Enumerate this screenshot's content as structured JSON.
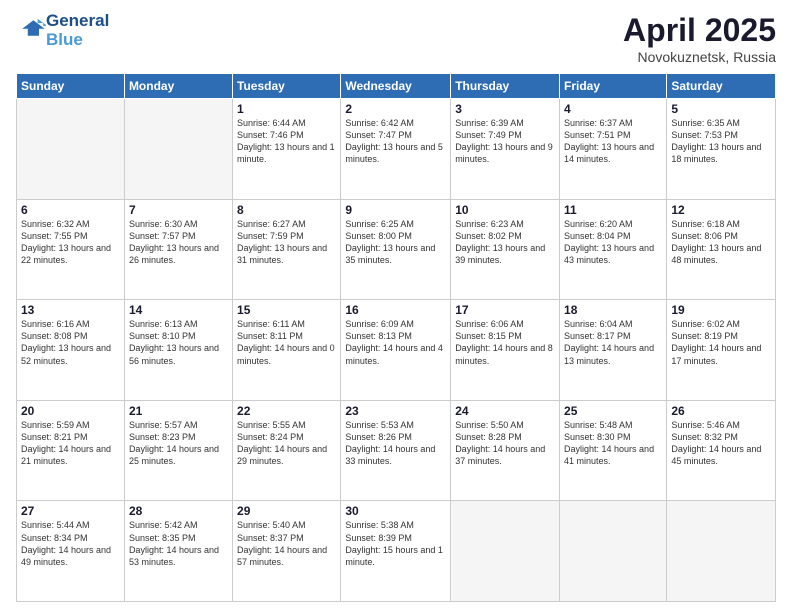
{
  "header": {
    "logo_line1": "General",
    "logo_line2": "Blue",
    "month": "April 2025",
    "location": "Novokuznetsk, Russia"
  },
  "weekdays": [
    "Sunday",
    "Monday",
    "Tuesday",
    "Wednesday",
    "Thursday",
    "Friday",
    "Saturday"
  ],
  "weeks": [
    [
      {
        "day": "",
        "info": ""
      },
      {
        "day": "",
        "info": ""
      },
      {
        "day": "1",
        "info": "Sunrise: 6:44 AM\nSunset: 7:46 PM\nDaylight: 13 hours and 1 minute."
      },
      {
        "day": "2",
        "info": "Sunrise: 6:42 AM\nSunset: 7:47 PM\nDaylight: 13 hours and 5 minutes."
      },
      {
        "day": "3",
        "info": "Sunrise: 6:39 AM\nSunset: 7:49 PM\nDaylight: 13 hours and 9 minutes."
      },
      {
        "day": "4",
        "info": "Sunrise: 6:37 AM\nSunset: 7:51 PM\nDaylight: 13 hours and 14 minutes."
      },
      {
        "day": "5",
        "info": "Sunrise: 6:35 AM\nSunset: 7:53 PM\nDaylight: 13 hours and 18 minutes."
      }
    ],
    [
      {
        "day": "6",
        "info": "Sunrise: 6:32 AM\nSunset: 7:55 PM\nDaylight: 13 hours and 22 minutes."
      },
      {
        "day": "7",
        "info": "Sunrise: 6:30 AM\nSunset: 7:57 PM\nDaylight: 13 hours and 26 minutes."
      },
      {
        "day": "8",
        "info": "Sunrise: 6:27 AM\nSunset: 7:59 PM\nDaylight: 13 hours and 31 minutes."
      },
      {
        "day": "9",
        "info": "Sunrise: 6:25 AM\nSunset: 8:00 PM\nDaylight: 13 hours and 35 minutes."
      },
      {
        "day": "10",
        "info": "Sunrise: 6:23 AM\nSunset: 8:02 PM\nDaylight: 13 hours and 39 minutes."
      },
      {
        "day": "11",
        "info": "Sunrise: 6:20 AM\nSunset: 8:04 PM\nDaylight: 13 hours and 43 minutes."
      },
      {
        "day": "12",
        "info": "Sunrise: 6:18 AM\nSunset: 8:06 PM\nDaylight: 13 hours and 48 minutes."
      }
    ],
    [
      {
        "day": "13",
        "info": "Sunrise: 6:16 AM\nSunset: 8:08 PM\nDaylight: 13 hours and 52 minutes."
      },
      {
        "day": "14",
        "info": "Sunrise: 6:13 AM\nSunset: 8:10 PM\nDaylight: 13 hours and 56 minutes."
      },
      {
        "day": "15",
        "info": "Sunrise: 6:11 AM\nSunset: 8:11 PM\nDaylight: 14 hours and 0 minutes."
      },
      {
        "day": "16",
        "info": "Sunrise: 6:09 AM\nSunset: 8:13 PM\nDaylight: 14 hours and 4 minutes."
      },
      {
        "day": "17",
        "info": "Sunrise: 6:06 AM\nSunset: 8:15 PM\nDaylight: 14 hours and 8 minutes."
      },
      {
        "day": "18",
        "info": "Sunrise: 6:04 AM\nSunset: 8:17 PM\nDaylight: 14 hours and 13 minutes."
      },
      {
        "day": "19",
        "info": "Sunrise: 6:02 AM\nSunset: 8:19 PM\nDaylight: 14 hours and 17 minutes."
      }
    ],
    [
      {
        "day": "20",
        "info": "Sunrise: 5:59 AM\nSunset: 8:21 PM\nDaylight: 14 hours and 21 minutes."
      },
      {
        "day": "21",
        "info": "Sunrise: 5:57 AM\nSunset: 8:23 PM\nDaylight: 14 hours and 25 minutes."
      },
      {
        "day": "22",
        "info": "Sunrise: 5:55 AM\nSunset: 8:24 PM\nDaylight: 14 hours and 29 minutes."
      },
      {
        "day": "23",
        "info": "Sunrise: 5:53 AM\nSunset: 8:26 PM\nDaylight: 14 hours and 33 minutes."
      },
      {
        "day": "24",
        "info": "Sunrise: 5:50 AM\nSunset: 8:28 PM\nDaylight: 14 hours and 37 minutes."
      },
      {
        "day": "25",
        "info": "Sunrise: 5:48 AM\nSunset: 8:30 PM\nDaylight: 14 hours and 41 minutes."
      },
      {
        "day": "26",
        "info": "Sunrise: 5:46 AM\nSunset: 8:32 PM\nDaylight: 14 hours and 45 minutes."
      }
    ],
    [
      {
        "day": "27",
        "info": "Sunrise: 5:44 AM\nSunset: 8:34 PM\nDaylight: 14 hours and 49 minutes."
      },
      {
        "day": "28",
        "info": "Sunrise: 5:42 AM\nSunset: 8:35 PM\nDaylight: 14 hours and 53 minutes."
      },
      {
        "day": "29",
        "info": "Sunrise: 5:40 AM\nSunset: 8:37 PM\nDaylight: 14 hours and 57 minutes."
      },
      {
        "day": "30",
        "info": "Sunrise: 5:38 AM\nSunset: 8:39 PM\nDaylight: 15 hours and 1 minute."
      },
      {
        "day": "",
        "info": ""
      },
      {
        "day": "",
        "info": ""
      },
      {
        "day": "",
        "info": ""
      }
    ]
  ]
}
